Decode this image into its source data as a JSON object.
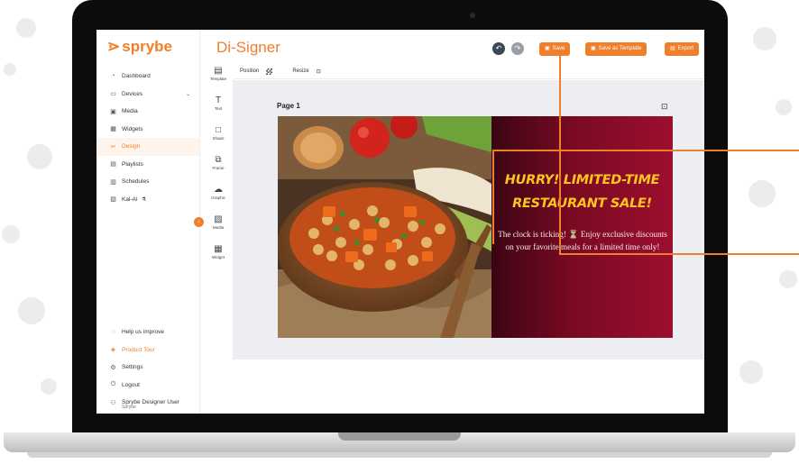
{
  "app": {
    "brand": "sprybe",
    "title": "Di-Signer"
  },
  "sidebar": {
    "items": [
      {
        "label": "Dashboard",
        "icon": "dashboard-icon",
        "glyph": "◔"
      },
      {
        "label": "Devices",
        "icon": "devices-icon",
        "glyph": "▭"
      },
      {
        "label": "Media",
        "icon": "media-icon",
        "glyph": "▣"
      },
      {
        "label": "Widgets",
        "icon": "widgets-icon",
        "glyph": "▦"
      },
      {
        "label": "Design",
        "icon": "design-icon",
        "glyph": "✂"
      },
      {
        "label": "Playlists",
        "icon": "playlists-icon",
        "glyph": "▤"
      },
      {
        "label": "Schedules",
        "icon": "schedules-icon",
        "glyph": "▥"
      },
      {
        "label": "Kal-AI",
        "icon": "ai-icon",
        "glyph": "▧"
      }
    ],
    "bottom": [
      {
        "label": "Help us improve",
        "icon": "help-icon",
        "glyph": "◌"
      },
      {
        "label": "Product Tour",
        "icon": "tour-icon",
        "glyph": "◈"
      },
      {
        "label": "Settings",
        "icon": "settings-icon",
        "glyph": "⚙"
      },
      {
        "label": "Logout",
        "icon": "logout-icon",
        "glyph": "⏻"
      },
      {
        "label": "Sprybe Designer User",
        "icon": "user-icon",
        "glyph": "⚇"
      }
    ],
    "user_sub": "Sprybe"
  },
  "tools": [
    {
      "label": "Template",
      "icon": "template-icon",
      "glyph": "▤"
    },
    {
      "label": "Text",
      "icon": "text-icon",
      "glyph": "T"
    },
    {
      "label": "Shape",
      "icon": "shape-icon",
      "glyph": "□"
    },
    {
      "label": "Frame",
      "icon": "frame-icon",
      "glyph": "⧉"
    },
    {
      "label": "Graphic",
      "icon": "graphic-icon",
      "glyph": "☁"
    },
    {
      "label": "Media",
      "icon": "media-tool-icon",
      "glyph": "▨"
    },
    {
      "label": "Widget",
      "icon": "widget-icon",
      "glyph": "▦"
    }
  ],
  "header": {
    "save": "Save",
    "save_template": "Save as Template",
    "export": "Export"
  },
  "subtoolbar": {
    "position": "Position",
    "resize": "Resize"
  },
  "canvas": {
    "page_label": "Page 1"
  },
  "slide": {
    "title_line1": "HURRY! LIMITED-TIME",
    "title_line2": "RESTAURANT SALE!",
    "body": "The clock is ticking! ⏳ Enjoy exclusive discounts on your favorite meals for a limited time only!"
  },
  "colors": {
    "accent": "#f07f2b",
    "promo_gradient_start": "#3b0413",
    "promo_gradient_end": "#9c0f2f",
    "title_yellow": "#ffc420"
  }
}
